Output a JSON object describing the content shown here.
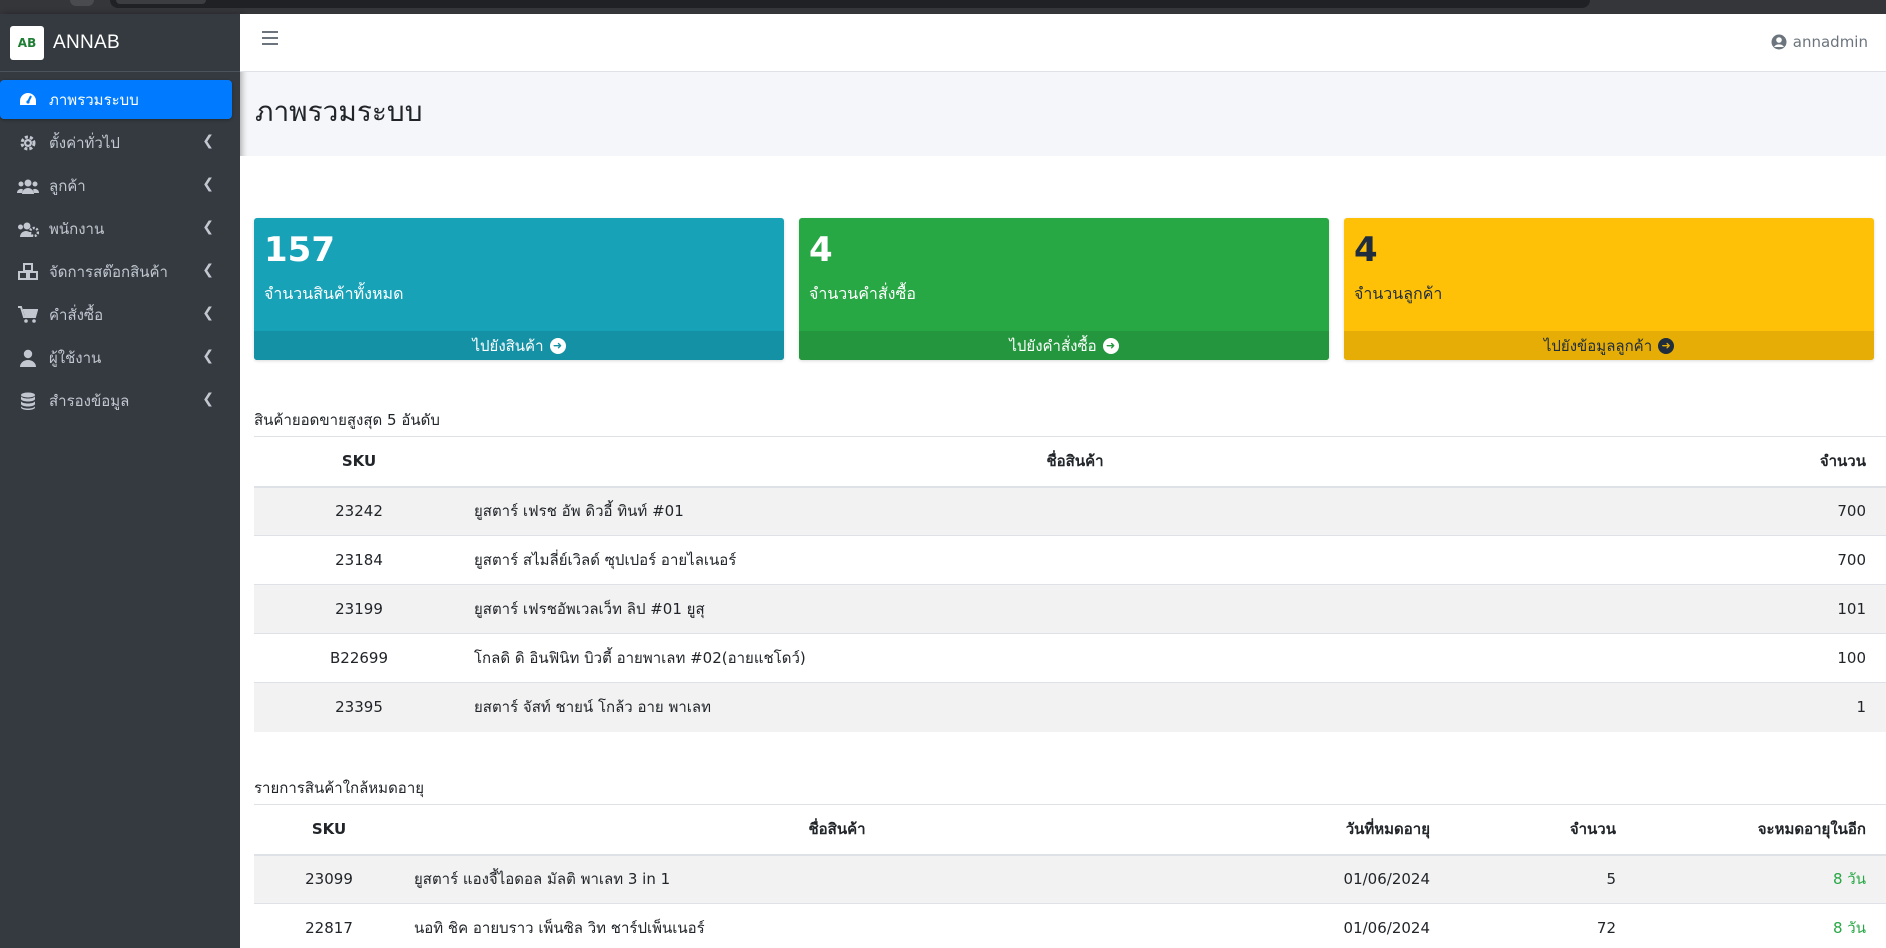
{
  "brand": {
    "logo_text": "AB",
    "name": "ANNAB"
  },
  "sidebar": {
    "items": [
      {
        "label": "ภาพรวมระบบ",
        "icon": "dashboard-icon",
        "active": true
      },
      {
        "label": "ตั้งค่าทั่วไป",
        "icon": "gear-icon"
      },
      {
        "label": "ลูกค้า",
        "icon": "users-icon"
      },
      {
        "label": "พนักงาน",
        "icon": "users-cog-icon"
      },
      {
        "label": "จัดการสต๊อกสินค้า",
        "icon": "cubes-icon"
      },
      {
        "label": "คำสั่งซื้อ",
        "icon": "cart-icon"
      },
      {
        "label": "ผู้ใช้งาน",
        "icon": "user-icon"
      },
      {
        "label": "สำรองข้อมูล",
        "icon": "database-icon"
      }
    ]
  },
  "header": {
    "username": "annadmin"
  },
  "page": {
    "title": "ภาพรวมระบบ"
  },
  "stats": [
    {
      "value": "157",
      "label": "จำนวนสินค้าทั้งหมด",
      "link": "ไปยังสินค้า",
      "color": "#17a2b8"
    },
    {
      "value": "4",
      "label": "จำนวนคำสั่งซื้อ",
      "link": "ไปยังคำสั่งซื้อ",
      "color": "#28a745"
    },
    {
      "value": "4",
      "label": "จำนวนลูกค้า",
      "link": "ไปยังข้อมูลลูกค้า",
      "color": "#ffc107"
    }
  ],
  "top_sellers": {
    "title": "สินค้ายอดขายสูงสุด 5 อันดับ",
    "headers": [
      "SKU",
      "ชื่อสินค้า",
      "จำนวน"
    ],
    "rows": [
      {
        "sku": "23242",
        "name": "ยูสตาร์ เฟรช อัพ ดิวอี้ ทินท์ #01",
        "qty": "700"
      },
      {
        "sku": "23184",
        "name": "ยูสตาร์ สไมลี่ย์เวิลด์ ซุปเปอร์ อายไลเนอร์",
        "qty": "700"
      },
      {
        "sku": "23199",
        "name": "ยูสตาร์ เฟรชอัพเวลเว็ท ลิป #01 ยูสุ",
        "qty": "101"
      },
      {
        "sku": "B22699",
        "name": "โกลดิ ดิ อินฟินิท บิวตี้ อายพาเลท #02(อายแชโดว์)",
        "qty": "100"
      },
      {
        "sku": "23395",
        "name": "ยสตาร์ จัสท์ ชายน์ โกล้ว อาย พาเลท",
        "qty": "1"
      }
    ]
  },
  "expiring": {
    "title": "รายการสินค้าใกล้หมดอายุ",
    "headers": [
      "SKU",
      "ชื่อสินค้า",
      "วันที่หมดอายุ",
      "จำนวน",
      "จะหมดอายุในอีก"
    ],
    "rows": [
      {
        "sku": "23099",
        "name": "ยูสตาร์ แองจี้ไอดอล มัลติ พาเลท 3 in 1",
        "date": "01/06/2024",
        "qty": "5",
        "remaining": "8 วัน"
      },
      {
        "sku": "22817",
        "name": "นอทิ ชิค อายบราว เพ็นซิล วิท ชาร์ปเพ็นเนอร์",
        "date": "01/06/2024",
        "qty": "72",
        "remaining": "8 วัน"
      }
    ]
  }
}
